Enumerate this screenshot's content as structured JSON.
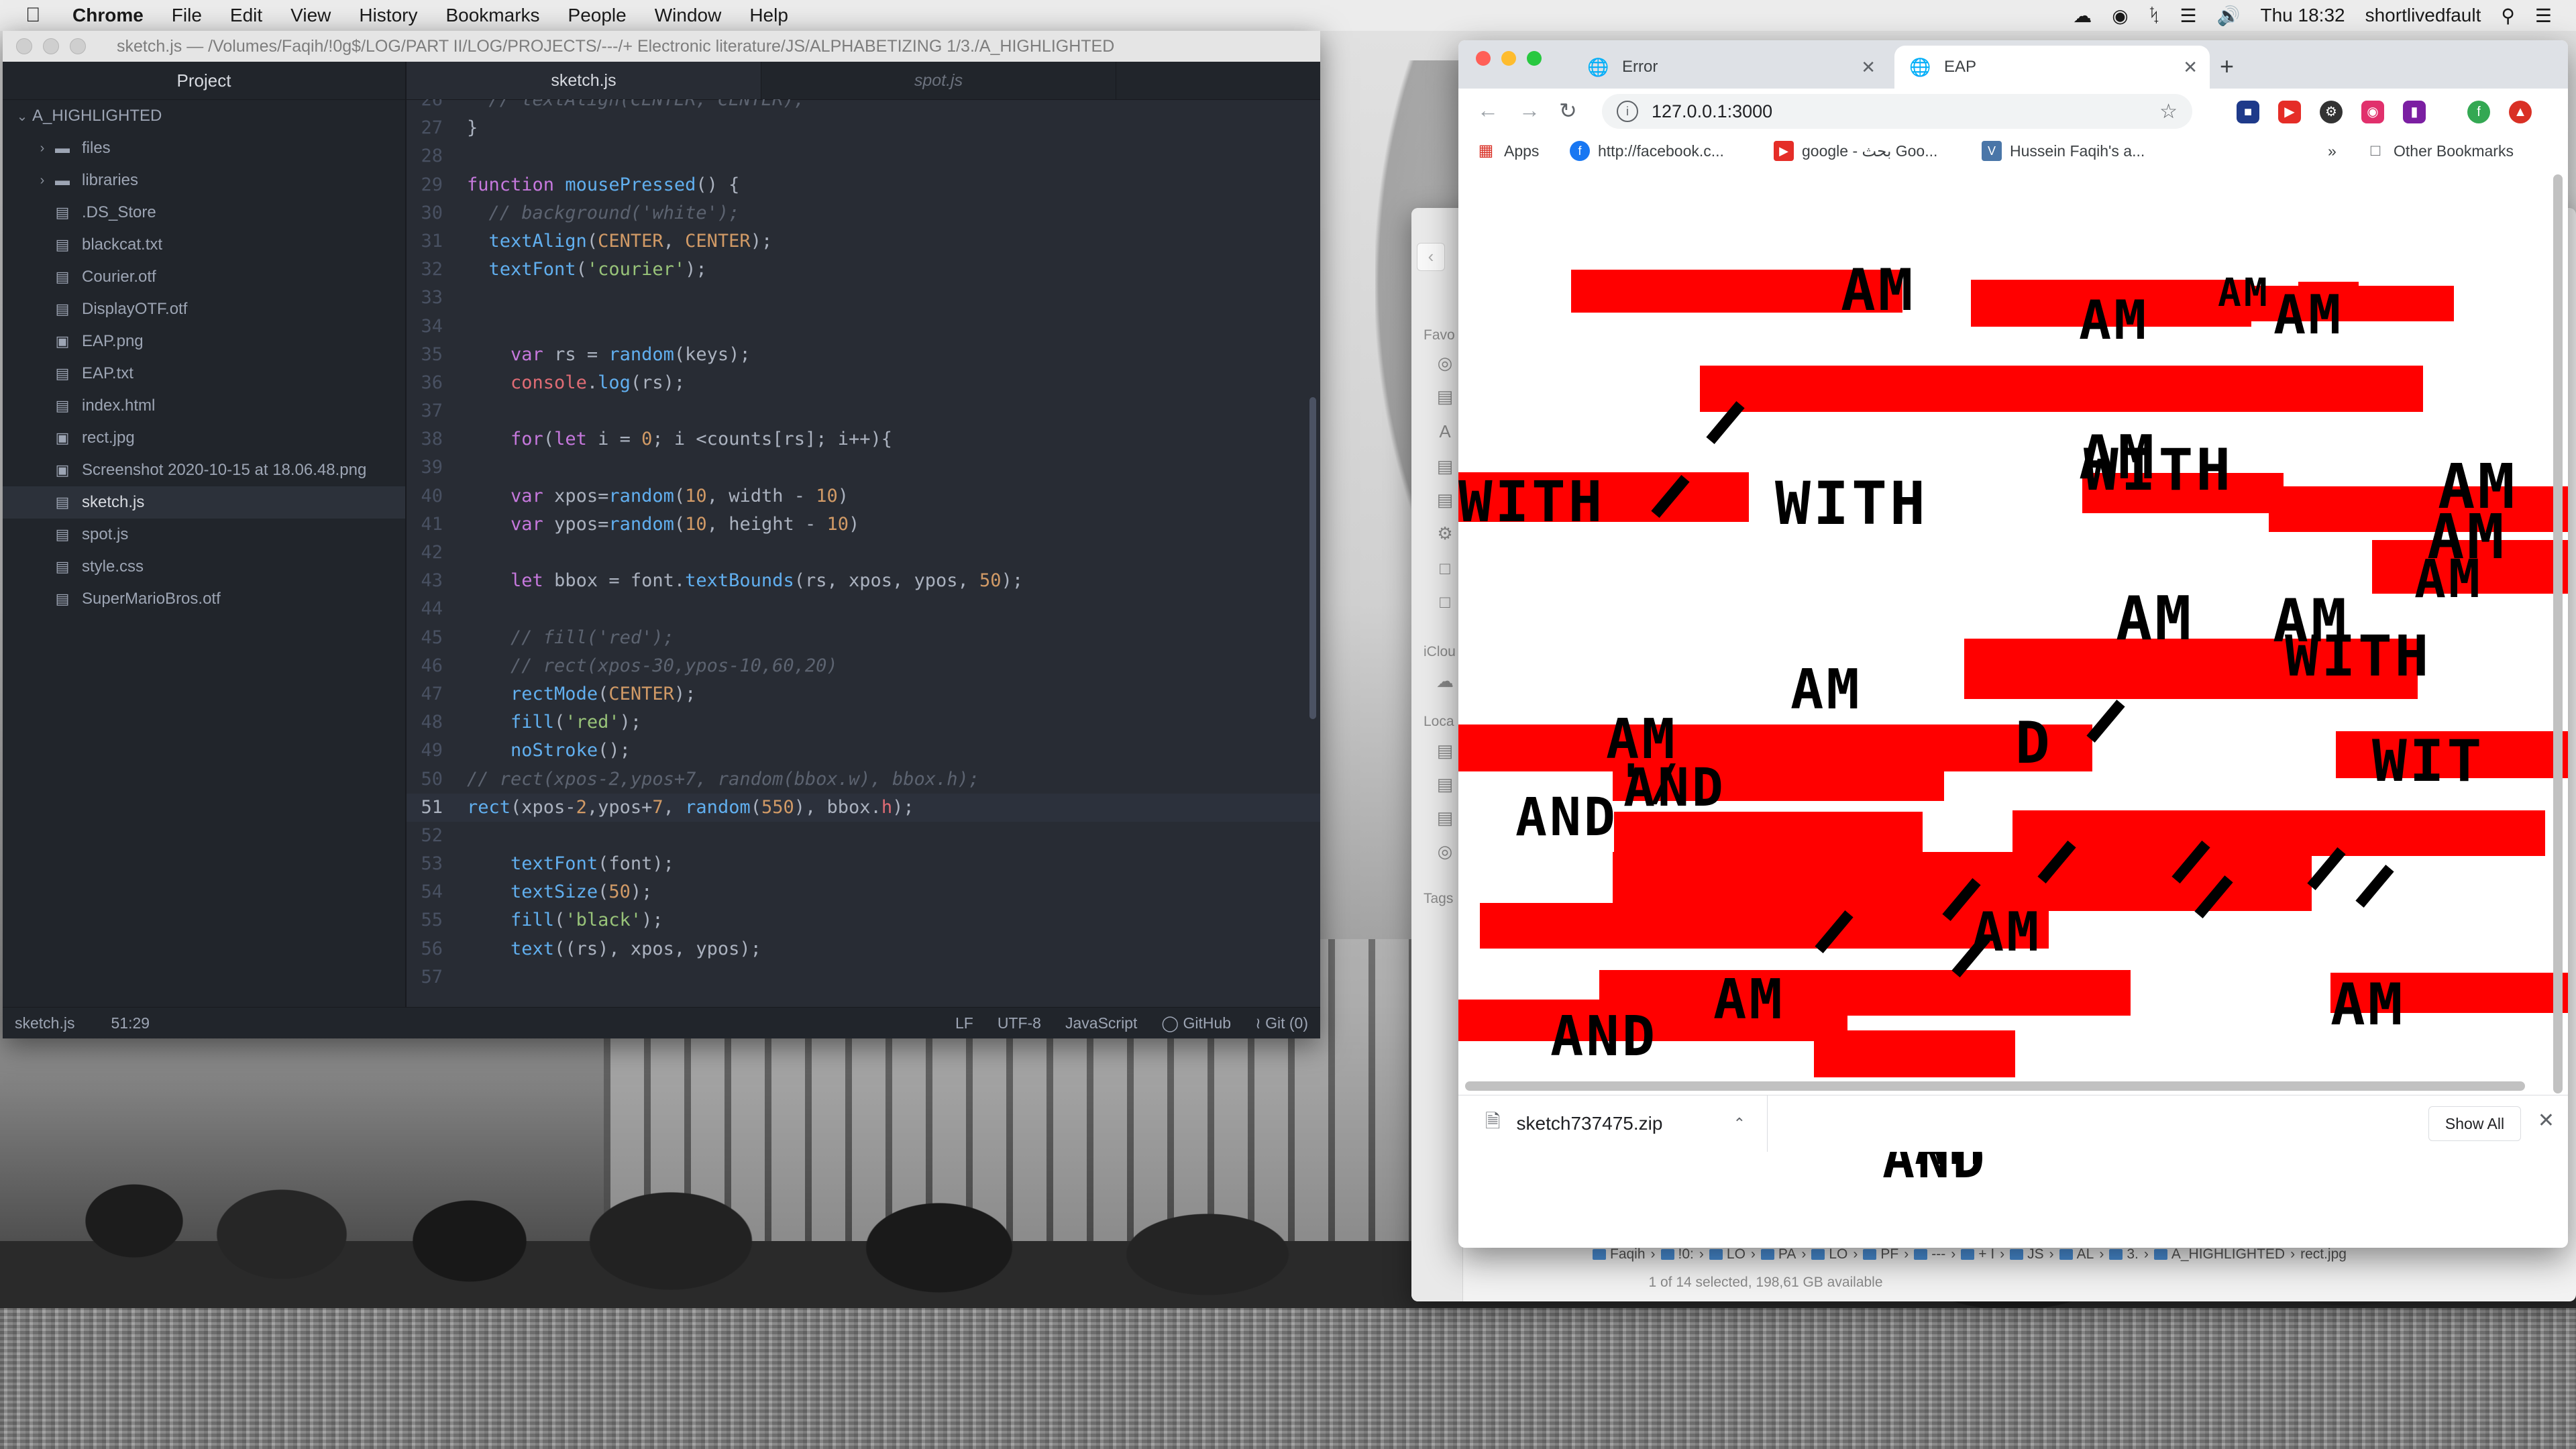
{
  "menubar": {
    "app": "Chrome",
    "items": [
      "File",
      "Edit",
      "View",
      "History",
      "Bookmarks",
      "People",
      "Window",
      "Help"
    ],
    "clock": "Thu 18:32",
    "user": "shortlivedfault"
  },
  "atom": {
    "title": "sketch.js — /Volumes/Faqih/!0g$/LOG/PART II/LOG/PROJECTS/---/+ Electronic literature/JS/ALPHABETIZING 1/3./A_HIGHLIGHTED",
    "tree_header": "Project",
    "root": "A_HIGHLIGHTED",
    "items": [
      {
        "name": "files",
        "type": "folder"
      },
      {
        "name": "libraries",
        "type": "folder"
      },
      {
        "name": ".DS_Store",
        "type": "file"
      },
      {
        "name": "blackcat.txt",
        "type": "file"
      },
      {
        "name": "Courier.otf",
        "type": "file"
      },
      {
        "name": "DisplayOTF.otf",
        "type": "file"
      },
      {
        "name": "EAP.png",
        "type": "image"
      },
      {
        "name": "EAP.txt",
        "type": "file"
      },
      {
        "name": "index.html",
        "type": "file"
      },
      {
        "name": "rect.jpg",
        "type": "image"
      },
      {
        "name": "Screenshot 2020-10-15 at 18.06.48.png",
        "type": "image"
      },
      {
        "name": "sketch.js",
        "type": "file"
      },
      {
        "name": "spot.js",
        "type": "file"
      },
      {
        "name": "style.css",
        "type": "file"
      },
      {
        "name": "SuperMarioBros.otf",
        "type": "file"
      }
    ],
    "tabs": [
      "sketch.js",
      "spot.js"
    ],
    "status": {
      "file": "sketch.js",
      "cursor": "51:29",
      "line_ending": "LF",
      "encoding": "UTF-8",
      "grammar": "JavaScript",
      "github": "GitHub",
      "git": "Git (0)"
    },
    "code_lines": [
      {
        "n": "26",
        "html": "<span class='cm'>  // textAlign(CENTER, CENTER);</span>"
      },
      {
        "n": "27",
        "html": "}"
      },
      {
        "n": "28",
        "html": ""
      },
      {
        "n": "29",
        "html": "<span class='kw'>function</span> <span class='fn'>mousePressed</span>() {"
      },
      {
        "n": "30",
        "html": "<span class='cm'>  // background('white');</span>"
      },
      {
        "n": "31",
        "html": "  <span class='fn'>textAlign</span>(<span class='cst'>CENTER</span>, <span class='cst'>CENTER</span>);"
      },
      {
        "n": "32",
        "html": "  <span class='fn'>textFont</span>(<span class='str'>'courier'</span>);"
      },
      {
        "n": "33",
        "html": ""
      },
      {
        "n": "34",
        "html": ""
      },
      {
        "n": "35",
        "html": "    <span class='kw'>var</span> rs = <span class='fn'>random</span>(keys);"
      },
      {
        "n": "36",
        "html": "    <span class='prop'>console</span>.<span class='fn'>log</span>(rs);"
      },
      {
        "n": "37",
        "html": ""
      },
      {
        "n": "38",
        "html": "    <span class='kw'>for</span>(<span class='kw'>let</span> i = <span class='num'>0</span>; i &lt;counts[rs]; i++){"
      },
      {
        "n": "39",
        "html": ""
      },
      {
        "n": "40",
        "html": "    <span class='kw'>var</span> xpos=<span class='fn'>random</span>(<span class='num'>10</span>, width - <span class='num'>10</span>)"
      },
      {
        "n": "41",
        "html": "    <span class='kw'>var</span> ypos=<span class='fn'>random</span>(<span class='num'>10</span>, height - <span class='num'>10</span>)"
      },
      {
        "n": "42",
        "html": ""
      },
      {
        "n": "43",
        "html": "    <span class='kw'>let</span> bbox = font.<span class='fn'>textBounds</span>(rs, xpos, ypos, <span class='num'>50</span>);"
      },
      {
        "n": "44",
        "html": ""
      },
      {
        "n": "45",
        "html": "<span class='cm'>    // fill('red');</span>"
      },
      {
        "n": "46",
        "html": "<span class='cm'>    // rect(xpos-30,ypos-10,60,20)</span>"
      },
      {
        "n": "47",
        "html": "    <span class='fn'>rectMode</span>(<span class='cst'>CENTER</span>);"
      },
      {
        "n": "48",
        "html": "    <span class='fn'>fill</span>(<span class='str'>'red'</span>);"
      },
      {
        "n": "49",
        "html": "    <span class='fn'>noStroke</span>();"
      },
      {
        "n": "50",
        "html": "<span class='cm'>// rect(xpos-2,ypos+7, random(bbox.w), bbox.h);</span>"
      },
      {
        "n": "51",
        "html": "<span class='fn'>rect</span>(xpos-<span class='num'>2</span>,ypos+<span class='num'>7</span>, <span class='fn'>random</span>(<span class='num'>550</span>), bbox.<span class='prop'>h</span>);"
      },
      {
        "n": "52",
        "html": ""
      },
      {
        "n": "53",
        "html": "    <span class='fn'>textFont</span>(font);"
      },
      {
        "n": "54",
        "html": "    <span class='fn'>textSize</span>(<span class='num'>50</span>);"
      },
      {
        "n": "55",
        "html": "    <span class='fn'>fill</span>(<span class='str'>'black'</span>);"
      },
      {
        "n": "56",
        "html": "    <span class='fn'>text</span>((rs), xpos, ypos);"
      },
      {
        "n": "57",
        "html": ""
      }
    ]
  },
  "finder": {
    "sidebar_labels": [
      "Favo",
      "iClou",
      "Loca",
      "Tags"
    ],
    "path": [
      "Faqih",
      "!0:",
      "LO",
      "PA",
      "LO",
      "PF",
      "---",
      "+ I",
      "JS",
      "AL",
      "3.",
      "A_HIGHLIGHTED",
      "rect.jpg"
    ],
    "status": "1 of 14 selected, 198,61 GB available"
  },
  "chrome": {
    "tabs": [
      {
        "title": "Error",
        "active": false
      },
      {
        "title": "EAP",
        "active": true
      }
    ],
    "url": "127.0.0.1:3000",
    "bookmarks": [
      {
        "label": "Apps",
        "icon": "apps-grid-icon"
      },
      {
        "label": "http://facebook.c...",
        "icon": "facebook-icon"
      },
      {
        "label": "google - بحث Goo...",
        "icon": "youtube-icon"
      },
      {
        "label": "Hussein Faqih's a...",
        "icon": "vk-icon"
      }
    ],
    "more_bookmarks": "»",
    "other_bookmarks": "Other Bookmarks",
    "download": {
      "file": "sketch737475.zip",
      "show_all": "Show All"
    },
    "canvas_words": [
      "AM",
      "AM",
      "AM",
      "AM",
      "AM",
      "AM",
      "AM",
      "AM",
      "AM",
      "AM",
      "AM",
      "AM",
      "AM",
      "AM",
      "WITH",
      "WITH",
      "WITH",
      "WITH",
      "WIT",
      "AND",
      "AND",
      "AND",
      "AN",
      "AND",
      "D",
      "'/",
      "/",
      "/",
      "/",
      "/",
      "/",
      "/",
      "/",
      "/",
      "/",
      "/",
      "/",
      "/"
    ]
  },
  "colors": {
    "canvas_rect": "#ff0000",
    "canvas_text": "#000000",
    "atom_bg": "#282c34"
  }
}
